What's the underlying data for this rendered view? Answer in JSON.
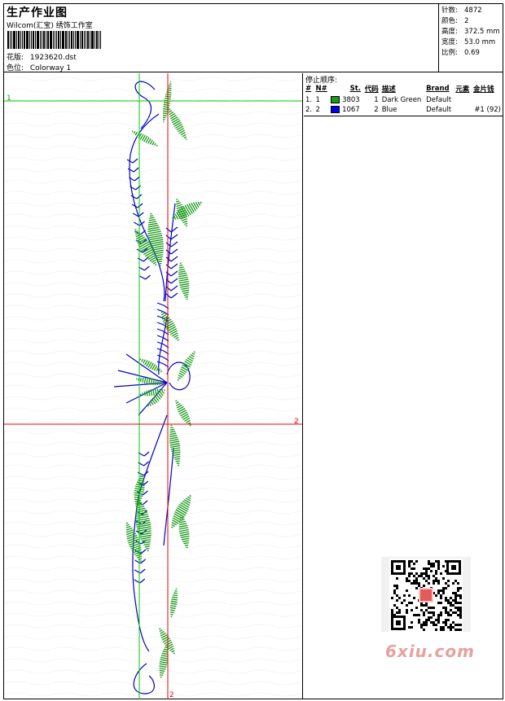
{
  "header": {
    "title": "生产作业图",
    "company": "Wilcom(汇宝) 绣饰工作室",
    "design_label": "花版:",
    "design_value": "1923620.dst",
    "colorway_label": "色位:",
    "colorway_value": "Colorway 1"
  },
  "stats": [
    {
      "label": "针数:",
      "value": "4872"
    },
    {
      "label": "颜色:",
      "value": "2"
    },
    {
      "label": "高度:",
      "value": "372.5 mm"
    },
    {
      "label": "宽度:",
      "value": "53.0 mm"
    },
    {
      "label": "比例:",
      "value": "0.69"
    }
  ],
  "stops": {
    "title": "停止顺序:",
    "columns": [
      "#",
      "N#",
      "St.",
      "代码",
      "描述",
      "Brand",
      "元素",
      "金片钱"
    ],
    "rows": [
      {
        "idx": "1.",
        "n": "1",
        "color": "#1a9a1a",
        "st": "3803",
        "code": "1",
        "desc": "Dark Green",
        "brand": "Default",
        "element": "",
        "sequin": ""
      },
      {
        "idx": "2.",
        "n": "2",
        "color": "#0000ee",
        "st": "1067",
        "code": "2",
        "desc": "Blue",
        "brand": "Default",
        "element": "",
        "sequin": "#1 (92)"
      }
    ]
  },
  "guides": {
    "marker_1": "1",
    "marker_2_right": "2",
    "marker_2_bottom": "2"
  },
  "colors": {
    "green_thread": "#1a9a1a",
    "blue_thread": "#0000cc",
    "guide_green": "#00cc00",
    "guide_red": "#ee0000"
  },
  "watermark": "6xiu.com"
}
